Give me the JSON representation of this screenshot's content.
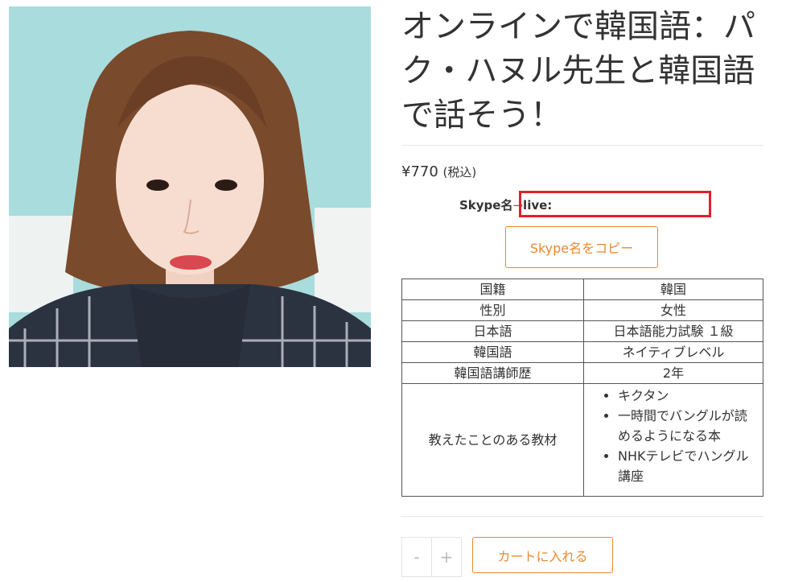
{
  "product": {
    "title": "オンラインで韓国語：パク・ハヌル先生と韓国語で話そう！",
    "price": "¥770",
    "tax_note": "(税込)"
  },
  "skype": {
    "label": "Skype名",
    "arrow": "→",
    "value": "live:",
    "copy_button_label": "Skype名をコピー",
    "highlight_color": "#e0202a"
  },
  "info_table": {
    "rows": [
      {
        "label": "国籍",
        "value": "韓国"
      },
      {
        "label": "性別",
        "value": "女性"
      },
      {
        "label": "日本語",
        "value": "日本語能力試験 １級"
      },
      {
        "label": "韓国語",
        "value": "ネイティブレベル"
      },
      {
        "label": "韓国語講師歴",
        "value": "2年"
      }
    ],
    "materials_label": "教えたことのある教材",
    "materials": [
      "キクタン",
      "一時間でバングルが読めるようになる本",
      "NHKテレビでハングル講座"
    ]
  },
  "cart": {
    "minus_label": "-",
    "plus_label": "+",
    "add_to_cart_label": "カートに入れる"
  },
  "colors": {
    "accent": "#e9892f",
    "text": "#333333",
    "border": "#555555"
  }
}
